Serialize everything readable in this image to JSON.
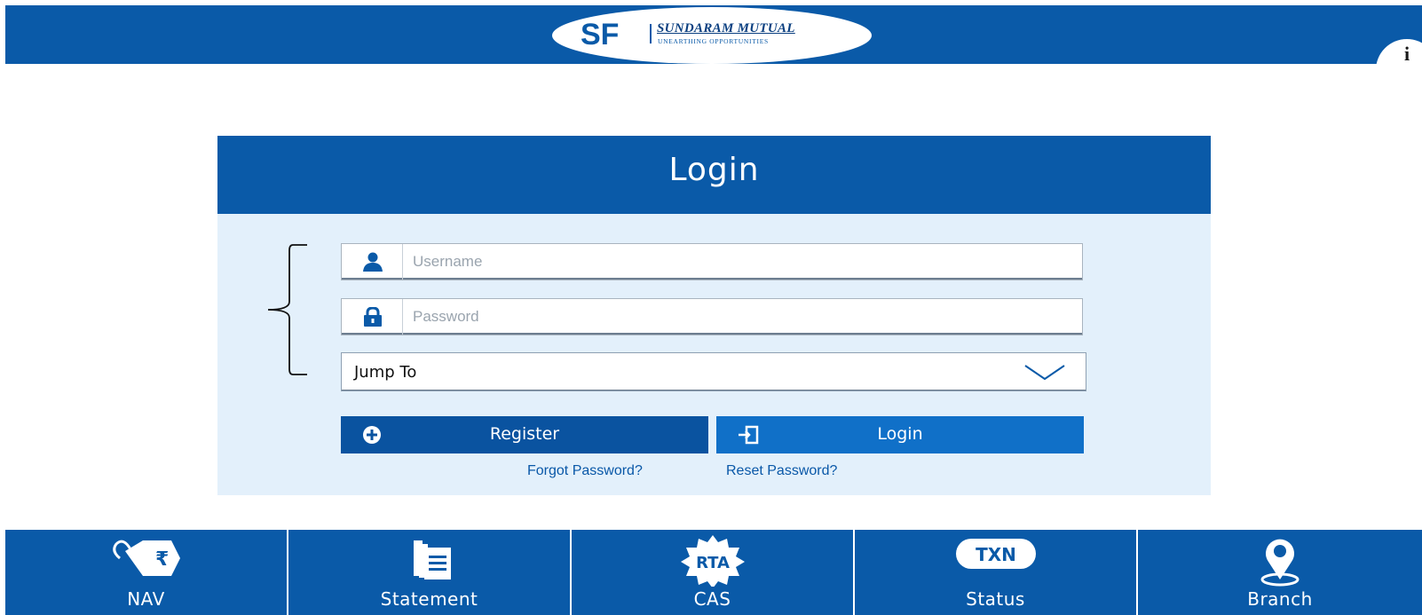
{
  "header": {
    "logo_monogram": "SF",
    "brand_name": "SUNDARAM MUTUAL",
    "brand_tagline": "UNEARTHING OPPORTUNITIES",
    "info_icon": "i",
    "brand_color": "#0a5aa8"
  },
  "login": {
    "title": "Login",
    "username_placeholder": "Username",
    "password_placeholder": "Password",
    "jump_to_label": "Jump To",
    "register_label": "Register",
    "login_label": "Login",
    "forgot_link": "Forgot Password?",
    "reset_link": "Reset Password?"
  },
  "nav": {
    "items": [
      {
        "label": "NAV",
        "icon": "rupee-tag-icon"
      },
      {
        "label": "Statement",
        "icon": "statement-icon"
      },
      {
        "label": "CAS",
        "icon": "rta-badge-icon",
        "badge": "RTA"
      },
      {
        "label": "Status",
        "icon": "txn-badge-icon",
        "badge": "TXN"
      },
      {
        "label": "Branch",
        "icon": "location-pin-icon"
      }
    ]
  },
  "colors": {
    "primary": "#0a5aa8",
    "card_bg": "#e3f0fb",
    "login_button": "#1070c8",
    "register_button": "#0a53a0"
  }
}
